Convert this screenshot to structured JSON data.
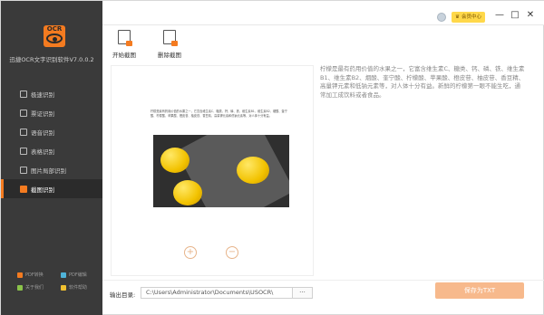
{
  "app": {
    "logo_text": "OCR",
    "title": "迅捷OCR文字识别软件V7.0.0.2"
  },
  "sidebar": {
    "items": [
      {
        "label": "极速识别",
        "icon": "scan-icon"
      },
      {
        "label": "票证识别",
        "icon": "ticket-icon"
      },
      {
        "label": "语音识别",
        "icon": "voice-icon"
      },
      {
        "label": "表格识别",
        "icon": "table-icon"
      },
      {
        "label": "图片局部识别",
        "icon": "image-region-icon"
      },
      {
        "label": "截图识别",
        "icon": "screenshot-icon",
        "active": true
      }
    ],
    "bottom_links": [
      {
        "label": "PDF转换",
        "color": "#f47b20"
      },
      {
        "label": "PDF编辑",
        "color": "#4fb3d9"
      },
      {
        "label": "关于我们",
        "color": "#8bc34a"
      },
      {
        "label": "软件帮助",
        "color": "#f0c030"
      }
    ]
  },
  "header": {
    "vip_label": "会员中心",
    "minimize": "—",
    "maximize": "□",
    "close": "✕"
  },
  "toolbar": {
    "start_label": "开始截图",
    "delete_label": "删除截图"
  },
  "preview": {
    "doc_text": "柠檬是最有药用价值的水果之一，它富含维生素C、糖类、钙、磷、铁、维生素B1、维生素B2、烟酸、奎宁酸、柠檬酸、苹果酸、橙皮苷、柚皮苷、香豆精、高量钾元素和低钠元素等，对人体十分有益。",
    "zoom_in": "+",
    "zoom_out": "−"
  },
  "result": {
    "text": "柠檬是最有药用价值的水果之一，它富含维生素C、糖类、钙、磷、铁、维生素B1、维生素B2、烟酸、奎宁酸、柠檬酸、苹果酸、橙皮苷、柚皮苷、香豆精、高量钾元素和低钠元素等，对人体十分有益。新鲜的柠檬第一眼不能生吃，通常加工成饮料或者食品。"
  },
  "footer": {
    "output_label": "输出目录:",
    "output_path": "C:\\Users\\Administrator\\Documents\\USOCR\\",
    "browse_label": "···",
    "save_label": "保存为TXT"
  },
  "colors": {
    "accent": "#f47b20",
    "sidebar_bg": "#3a3a3a",
    "save_button": "#f7b98c"
  }
}
